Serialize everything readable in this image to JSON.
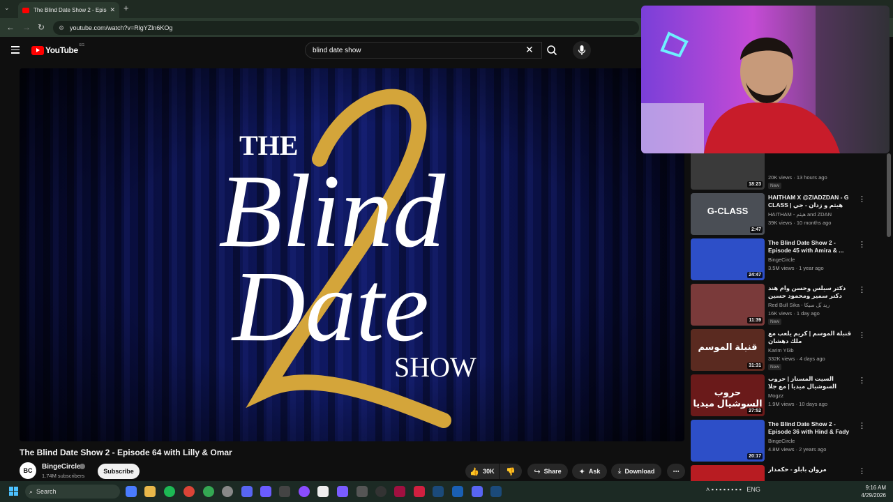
{
  "browser": {
    "tab_title": "The Blind Date Show 2 - Episod",
    "tab_close": "✕",
    "new_tab": "+",
    "url": "youtube.com/watch?v=RlgYZln6KOg"
  },
  "masthead": {
    "logo_text": "YouTube",
    "country": "EG",
    "search_value": "blind date show",
    "clear_label": "✕"
  },
  "player": {
    "title_line1": "THE",
    "title_script1": "Blind",
    "title_script2": "Date",
    "title_line2": "SHOW",
    "season_numeral": "2"
  },
  "video": {
    "title": "The Blind Date Show 2 - Episode 64 with Lilly & Omar",
    "channel_avatar": "BC",
    "channel_name": "BingeCircle",
    "subscribers": "1.74M subscribers",
    "subscribe_label": "Subscribe",
    "likes": "30K",
    "share_label": "Share",
    "ask_label": "Ask",
    "download_label": "Download",
    "more_label": "⋯"
  },
  "recommendations": [
    {
      "title": "",
      "channel": "",
      "views": "20K views · 13 hours ago",
      "badge": "New",
      "duration": "18:23",
      "color": "#3a3a3a"
    },
    {
      "title": "HAITHAM X @ZIADZDAN - G CLASS | هيثم و زدان - جي كلاس ...",
      "channel": "HAITHAM - هيثم and ZDAN",
      "views": "39K views · 10 months ago",
      "badge": "",
      "duration": "2:47",
      "color": "#4a4e55",
      "thumb_text": "G-CLASS"
    },
    {
      "title": "The Blind Date Show 2 - Episode 45 with Amira & ...",
      "channel": "BingeCircle",
      "views": "3.5M views · 1 year ago",
      "badge": "",
      "duration": "24:47",
      "color": "#2d4fc8"
    },
    {
      "title": "دكتر سيلس وحسن وام هند دكتر سمير ومحمود حسين Red Bull Mic Flex",
      "channel": "Red Bull Sika - ريد بُل سيكا",
      "views": "16K views · 1 day ago",
      "badge": "New",
      "duration": "11:39",
      "color": "#7a3a3a"
    },
    {
      "title": "قنبلة الموسم | كريم يلعب مع ملك دهشان",
      "channel": "Karim Yl3b",
      "views": "332K views · 4 days ago",
      "badge": "New",
      "duration": "31:31",
      "color": "#5a2a20",
      "thumb_text": "قنبلة الموسم"
    },
    {
      "title": "السيت المستاز | حروب السوشيال ميديا | مع جلا هشام | Egyptian Drama",
      "channel": "Mogzz",
      "views": "1.9M views · 10 days ago",
      "badge": "",
      "duration": "27:52",
      "color": "#6a1a1a",
      "thumb_text": "حروب السوشيال ميديا"
    },
    {
      "title": "The Blind Date Show 2 - Episode 36 with Hind & Fady",
      "channel": "BingeCircle",
      "views": "4.8M views · 2 years ago",
      "badge": "",
      "duration": "20:17",
      "color": "#2d4fc8"
    },
    {
      "title": "مروان بابلو - حكمدار",
      "channel": "MARWAN PABLO",
      "views": "1.1M views · 2 weeks ago",
      "badge": "",
      "duration": "",
      "color": "#b81c22"
    }
  ],
  "taskbar": {
    "search_label": "Search",
    "language": "ENG",
    "time": "9:16 AM",
    "date": "4/29/2026"
  },
  "icons": {
    "back": "back-arrow-icon",
    "forward": "forward-arrow-icon",
    "reload": "reload-icon",
    "search": "search-icon",
    "mic": "microphone-icon",
    "like": "thumbs-up-icon",
    "dislike": "thumbs-down-icon",
    "share": "share-arrow-icon",
    "ask": "sparkle-icon",
    "download": "download-icon"
  },
  "colors": {
    "background": "#0f0f0f",
    "brand_red": "#ff0000",
    "gold": "#d4a53a",
    "curtain": "#0d1550",
    "chrome_frame": "#2b3a2f"
  }
}
